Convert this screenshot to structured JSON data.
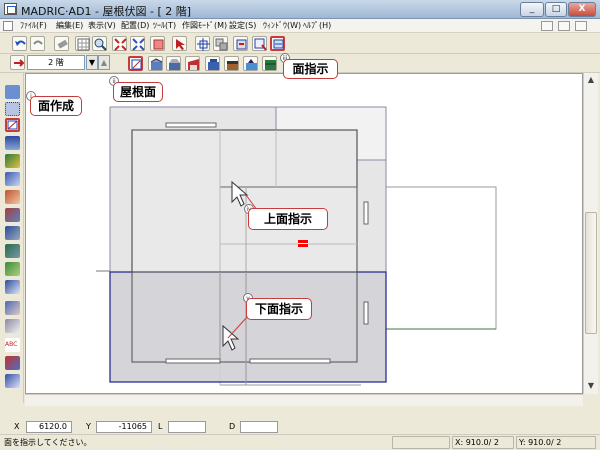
{
  "window": {
    "title": "MADRIC·AD1 - 屋根伏図 - [ 2 階]",
    "minimize_label": "_",
    "maximize_label": "□",
    "close_label": "X"
  },
  "menu": [
    {
      "id": "file",
      "label": "ﾌｧｲﾙ(F)"
    },
    {
      "id": "edit",
      "label": "編集(E)"
    },
    {
      "id": "view",
      "label": "表示(V)"
    },
    {
      "id": "place",
      "label": "配置(D)"
    },
    {
      "id": "tool",
      "label": "ﾂｰﾙ(T)"
    },
    {
      "id": "mode",
      "label": "作図ﾓｰﾄﾞ(M)"
    },
    {
      "id": "settings",
      "label": "設定(S)"
    },
    {
      "id": "window",
      "label": "ｳｨﾝﾄﾞｳ(W)"
    },
    {
      "id": "help",
      "label": "ﾍﾙﾌﾟ(H)"
    }
  ],
  "floor_select": {
    "value": "2 階",
    "down": "▼",
    "up": "▲"
  },
  "callouts": {
    "face_pick": {
      "label": "面指示",
      "badge": "iii"
    },
    "roof_face": {
      "label": "屋根面",
      "badge": "ii"
    },
    "face_create": {
      "label": "面作成",
      "badge": "i"
    },
    "top_face_pick": {
      "label": "上面指示",
      "badge": "iv"
    },
    "bottom_face_pick": {
      "label": "下面指示",
      "badge": "v"
    }
  },
  "coordinates": {
    "x_label": "X",
    "x_value": "6120.0",
    "y_label": "Y",
    "y_value": "-11065",
    "l_label": "L",
    "l_value": "",
    "d_label": "D",
    "d_value": ""
  },
  "status": {
    "message": "面を指示してください。",
    "x_info": "X: 910.0/ 2",
    "y_info": "Y: 910.0/ 2"
  },
  "colors": {
    "accent_red": "#c73b3b",
    "selection_band": "#1e1e8c",
    "marker": "#ff0000"
  }
}
